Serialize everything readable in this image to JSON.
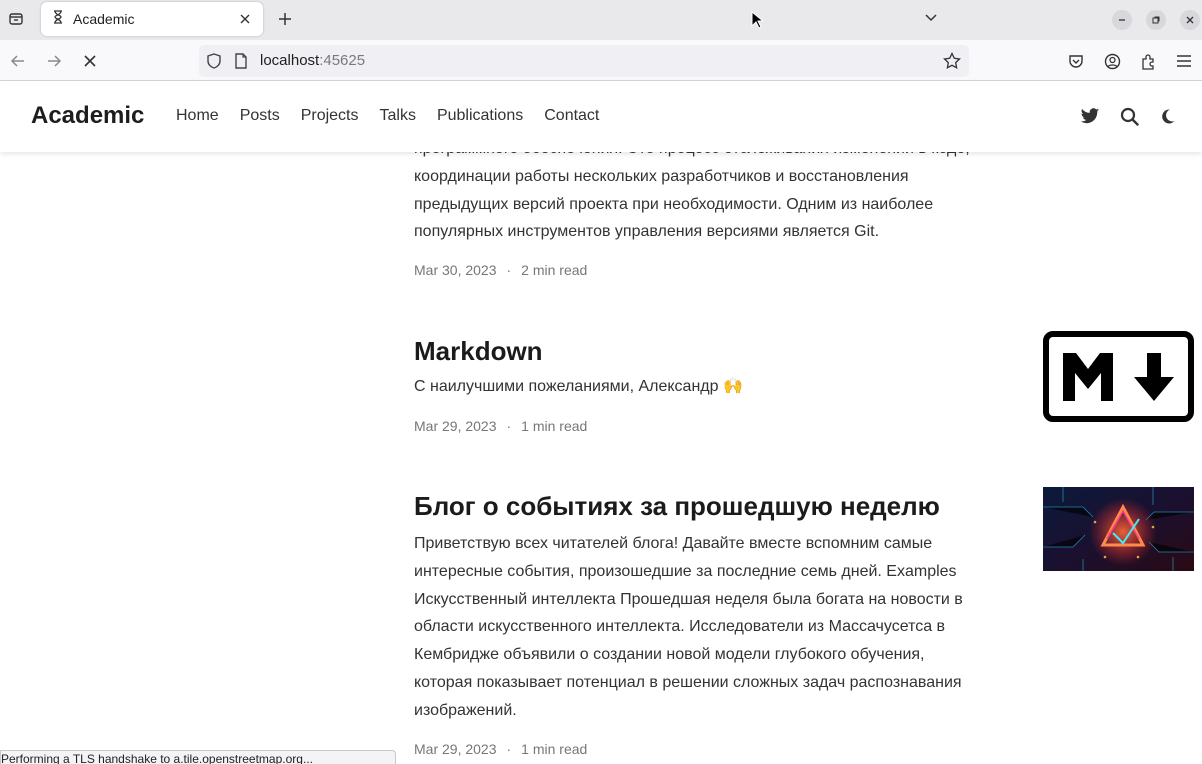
{
  "browser": {
    "tab_title": "Academic",
    "url_host": "localhost",
    "url_port": ":45625",
    "status_text": "Performing a TLS handshake to a.tile.openstreetmap.org..."
  },
  "site": {
    "brand": "Academic",
    "menu": [
      "Home",
      "Posts",
      "Projects",
      "Talks",
      "Publications",
      "Contact"
    ]
  },
  "posts": [
    {
      "summary_lines": [
        "программного обеспечения. Это процесс отслеживания изменений в коде,",
        "координации работы нескольких разработчиков и восстановления",
        "предыдущих версий проекта при необходимости. Одним из наиболее",
        "популярных инструментов управления версиями является Git."
      ],
      "date": "Mar 30, 2023",
      "read_time": "2 min read"
    },
    {
      "title": "Markdown",
      "summary_lines": [
        "С наилучшими пожеланиями, Александр 🙌"
      ],
      "date": "Mar 29, 2023",
      "read_time": "1 min read",
      "thumb": "markdown-logo"
    },
    {
      "title": "Блог о событиях за прошедшую неделю",
      "summary_lines": [
        "Приветствую всех читателей блога! Давайте вместе вспомним самые",
        "интересные события, произошедшие за последние семь дней. Examples",
        "Искусственный интеллекта Прошедшая неделя была богата на новости в",
        "области искусственного интеллекта. Исследователи из Массачусетса в",
        "Кембридже объявили о создании новой модели глубокого обучения,",
        "которая показывает потенциал в решении сложных задач распознавания",
        "изображений."
      ],
      "date": "Mar 29, 2023",
      "read_time": "1 min read",
      "thumb": "ai-chip-image"
    }
  ],
  "meta_separator": "·",
  "colors": {
    "accent": "#1565c0",
    "text": "#333333",
    "muted": "#777777"
  }
}
